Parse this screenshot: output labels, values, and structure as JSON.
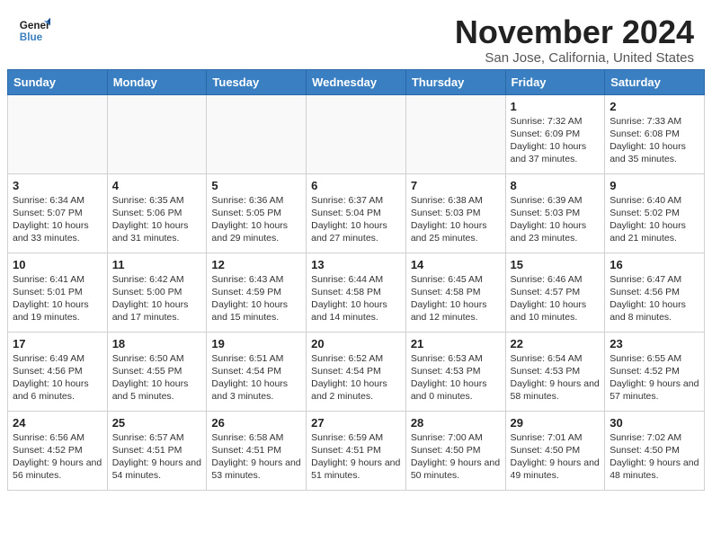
{
  "logo": {
    "line1": "General",
    "line2": "Blue"
  },
  "title": "November 2024",
  "subtitle": "San Jose, California, United States",
  "days_of_week": [
    "Sunday",
    "Monday",
    "Tuesday",
    "Wednesday",
    "Thursday",
    "Friday",
    "Saturday"
  ],
  "weeks": [
    [
      {
        "day": "",
        "info": ""
      },
      {
        "day": "",
        "info": ""
      },
      {
        "day": "",
        "info": ""
      },
      {
        "day": "",
        "info": ""
      },
      {
        "day": "",
        "info": ""
      },
      {
        "day": "1",
        "info": "Sunrise: 7:32 AM\nSunset: 6:09 PM\nDaylight: 10 hours and 37 minutes."
      },
      {
        "day": "2",
        "info": "Sunrise: 7:33 AM\nSunset: 6:08 PM\nDaylight: 10 hours and 35 minutes."
      }
    ],
    [
      {
        "day": "3",
        "info": "Sunrise: 6:34 AM\nSunset: 5:07 PM\nDaylight: 10 hours and 33 minutes."
      },
      {
        "day": "4",
        "info": "Sunrise: 6:35 AM\nSunset: 5:06 PM\nDaylight: 10 hours and 31 minutes."
      },
      {
        "day": "5",
        "info": "Sunrise: 6:36 AM\nSunset: 5:05 PM\nDaylight: 10 hours and 29 minutes."
      },
      {
        "day": "6",
        "info": "Sunrise: 6:37 AM\nSunset: 5:04 PM\nDaylight: 10 hours and 27 minutes."
      },
      {
        "day": "7",
        "info": "Sunrise: 6:38 AM\nSunset: 5:03 PM\nDaylight: 10 hours and 25 minutes."
      },
      {
        "day": "8",
        "info": "Sunrise: 6:39 AM\nSunset: 5:03 PM\nDaylight: 10 hours and 23 minutes."
      },
      {
        "day": "9",
        "info": "Sunrise: 6:40 AM\nSunset: 5:02 PM\nDaylight: 10 hours and 21 minutes."
      }
    ],
    [
      {
        "day": "10",
        "info": "Sunrise: 6:41 AM\nSunset: 5:01 PM\nDaylight: 10 hours and 19 minutes."
      },
      {
        "day": "11",
        "info": "Sunrise: 6:42 AM\nSunset: 5:00 PM\nDaylight: 10 hours and 17 minutes."
      },
      {
        "day": "12",
        "info": "Sunrise: 6:43 AM\nSunset: 4:59 PM\nDaylight: 10 hours and 15 minutes."
      },
      {
        "day": "13",
        "info": "Sunrise: 6:44 AM\nSunset: 4:58 PM\nDaylight: 10 hours and 14 minutes."
      },
      {
        "day": "14",
        "info": "Sunrise: 6:45 AM\nSunset: 4:58 PM\nDaylight: 10 hours and 12 minutes."
      },
      {
        "day": "15",
        "info": "Sunrise: 6:46 AM\nSunset: 4:57 PM\nDaylight: 10 hours and 10 minutes."
      },
      {
        "day": "16",
        "info": "Sunrise: 6:47 AM\nSunset: 4:56 PM\nDaylight: 10 hours and 8 minutes."
      }
    ],
    [
      {
        "day": "17",
        "info": "Sunrise: 6:49 AM\nSunset: 4:56 PM\nDaylight: 10 hours and 6 minutes."
      },
      {
        "day": "18",
        "info": "Sunrise: 6:50 AM\nSunset: 4:55 PM\nDaylight: 10 hours and 5 minutes."
      },
      {
        "day": "19",
        "info": "Sunrise: 6:51 AM\nSunset: 4:54 PM\nDaylight: 10 hours and 3 minutes."
      },
      {
        "day": "20",
        "info": "Sunrise: 6:52 AM\nSunset: 4:54 PM\nDaylight: 10 hours and 2 minutes."
      },
      {
        "day": "21",
        "info": "Sunrise: 6:53 AM\nSunset: 4:53 PM\nDaylight: 10 hours and 0 minutes."
      },
      {
        "day": "22",
        "info": "Sunrise: 6:54 AM\nSunset: 4:53 PM\nDaylight: 9 hours and 58 minutes."
      },
      {
        "day": "23",
        "info": "Sunrise: 6:55 AM\nSunset: 4:52 PM\nDaylight: 9 hours and 57 minutes."
      }
    ],
    [
      {
        "day": "24",
        "info": "Sunrise: 6:56 AM\nSunset: 4:52 PM\nDaylight: 9 hours and 56 minutes."
      },
      {
        "day": "25",
        "info": "Sunrise: 6:57 AM\nSunset: 4:51 PM\nDaylight: 9 hours and 54 minutes."
      },
      {
        "day": "26",
        "info": "Sunrise: 6:58 AM\nSunset: 4:51 PM\nDaylight: 9 hours and 53 minutes."
      },
      {
        "day": "27",
        "info": "Sunrise: 6:59 AM\nSunset: 4:51 PM\nDaylight: 9 hours and 51 minutes."
      },
      {
        "day": "28",
        "info": "Sunrise: 7:00 AM\nSunset: 4:50 PM\nDaylight: 9 hours and 50 minutes."
      },
      {
        "day": "29",
        "info": "Sunrise: 7:01 AM\nSunset: 4:50 PM\nDaylight: 9 hours and 49 minutes."
      },
      {
        "day": "30",
        "info": "Sunrise: 7:02 AM\nSunset: 4:50 PM\nDaylight: 9 hours and 48 minutes."
      }
    ]
  ]
}
